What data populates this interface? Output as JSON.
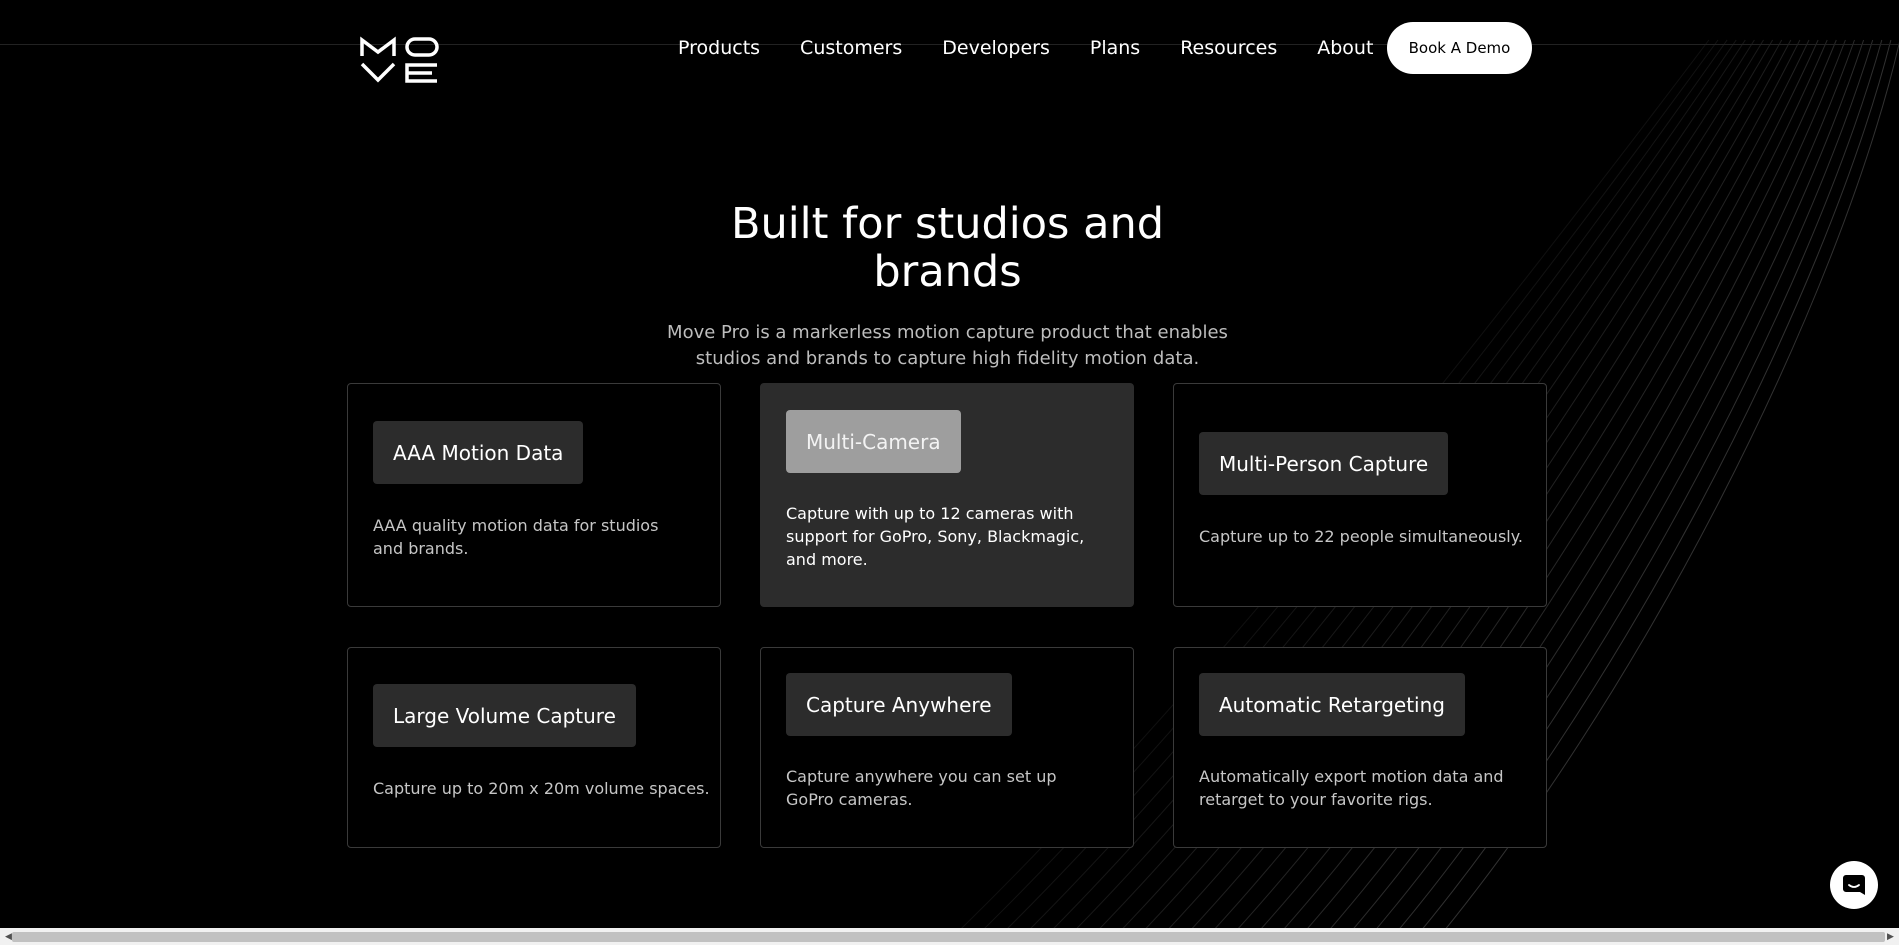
{
  "nav": {
    "items": [
      {
        "label": "Products"
      },
      {
        "label": "Customers"
      },
      {
        "label": "Developers"
      },
      {
        "label": "Plans"
      },
      {
        "label": "Resources"
      },
      {
        "label": "About"
      }
    ],
    "demo_label": "Book A Demo"
  },
  "hero": {
    "title_line1": "Built for studios and",
    "title_line2": "brands",
    "subtitle_line1": "Move Pro is a markerless motion capture product that enables",
    "subtitle_line2": "studios and brands to capture high fidelity motion data."
  },
  "features": [
    {
      "title": "AAA Motion Data",
      "description": "AAA quality motion data for studios and brands."
    },
    {
      "title": "Multi-Camera",
      "description": "Capture with up to 12 cameras with support for GoPro, Sony, Blackmagic, and more."
    },
    {
      "title": "Multi-Person Capture",
      "description": "Capture up to 22 people simultaneously."
    },
    {
      "title": "Large Volume Capture",
      "description": "Capture up to 20m x 20m volume spaces."
    },
    {
      "title": "Capture Anywhere",
      "description": "Capture anywhere you can set up GoPro cameras."
    },
    {
      "title": "Automatic Retargeting",
      "description": "Automatically export motion data and retarget to your favorite rigs."
    }
  ],
  "icons": {
    "logo": "move-logo-icon",
    "chat": "chat-bubble-icon"
  },
  "colors": {
    "background": "#000000",
    "card_border": "#3a3a3a",
    "chip": "#2c2c2c",
    "active_chip": "#9e9e9e"
  }
}
